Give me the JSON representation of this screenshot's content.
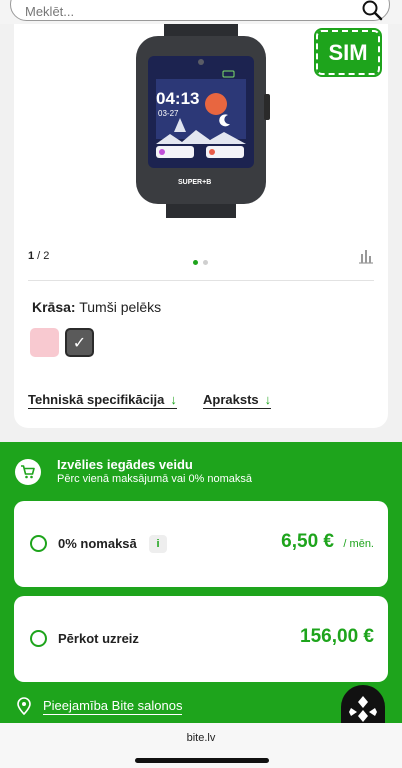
{
  "search": {
    "placeholder": "Meklēt..."
  },
  "product": {
    "badge": "SIM",
    "watch_time": "04:13",
    "watch_date": "03-27",
    "watch_brand": "SUPER+B",
    "pager_current": "1",
    "pager_total": "2",
    "color_label": "Krāsa:",
    "color_value": "Tumši pelēks",
    "selected_check": "✓",
    "links": {
      "specs": "Tehniskā specifikācija",
      "description": "Apraksts",
      "arrow": "↓"
    }
  },
  "purchase": {
    "title": "Izvēlies iegādes veidu",
    "subtitle": "Pērc vienā maksājumā vai 0% nomaksā",
    "options": [
      {
        "label": "0% nomaksā",
        "info": "i",
        "price": "6,50 €",
        "unit": "/ mēn."
      },
      {
        "label": "Pērkot uzreiz",
        "price": "156,00 €"
      }
    ],
    "availability": "Pieejamība Bite salonos"
  },
  "browser": {
    "url": "bite.lv"
  },
  "colors": {
    "accent": "#1ea41c",
    "swatch_pink": "#f8c9d0",
    "swatch_grey": "#5a5a5a"
  }
}
